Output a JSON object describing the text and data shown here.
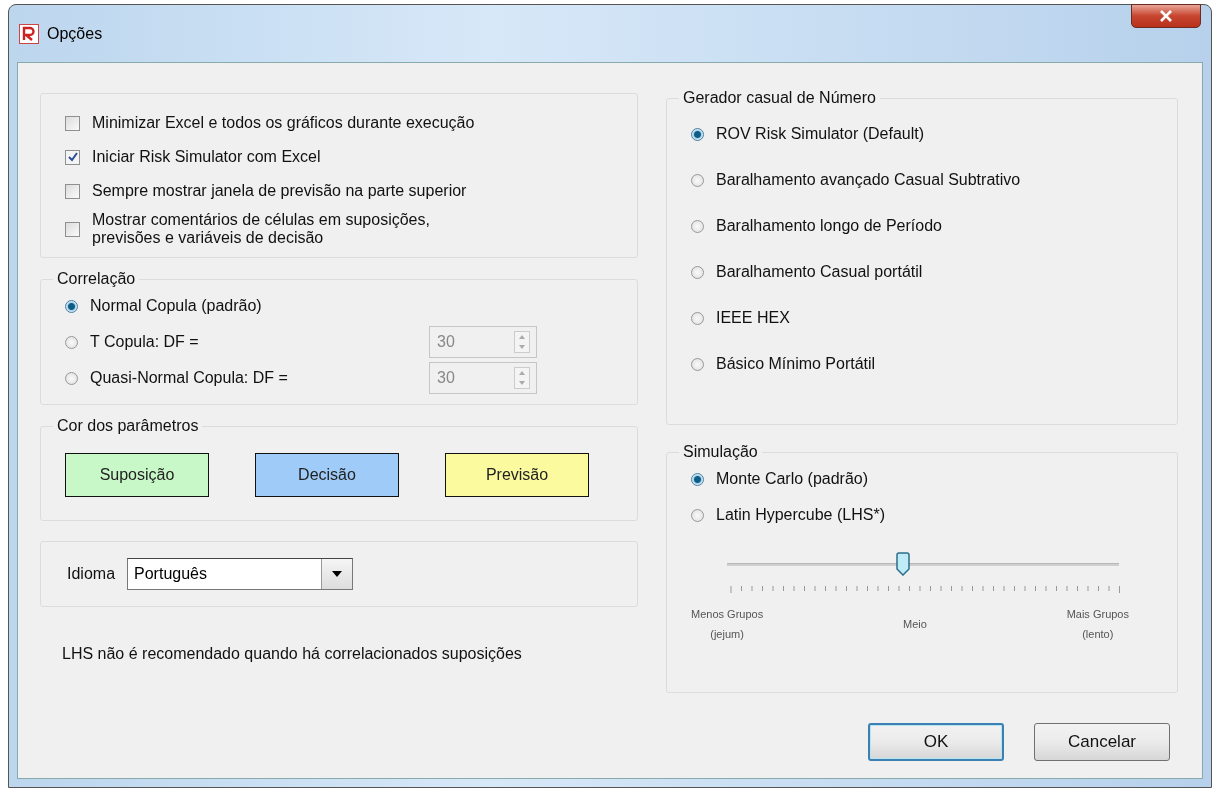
{
  "window": {
    "title": "Opções"
  },
  "general_options": [
    {
      "label": "Minimizar Excel e todos os gráficos durante execução",
      "checked": false
    },
    {
      "label": "Iniciar Risk Simulator com Excel",
      "checked": true
    },
    {
      "label": "Sempre mostrar janela de previsão na parte superior",
      "checked": false
    },
    {
      "label": "Mostrar comentários de células em suposições,\nprevisões e variáveis de decisão",
      "checked": false
    }
  ],
  "correlation": {
    "title": "Correlação",
    "options": [
      {
        "label": "Normal Copula (padrão)",
        "selected": true
      },
      {
        "label": "T Copula: DF =",
        "selected": false,
        "spinner": {
          "value": "30",
          "disabled": true
        }
      },
      {
        "label": "Quasi-Normal Copula: DF =",
        "selected": false,
        "spinner": {
          "value": "30",
          "disabled": true
        }
      }
    ]
  },
  "parameter_colors": {
    "title": "Cor dos parâmetros",
    "swatches": [
      {
        "label": "Suposição",
        "color": "#c8f7c8"
      },
      {
        "label": "Decisão",
        "color": "#9ecbf7"
      },
      {
        "label": "Previsão",
        "color": "#fbfa9e"
      }
    ]
  },
  "language": {
    "label": "Idioma",
    "value": "Português"
  },
  "note": "LHS não é recomendado quando há correlacionados suposições",
  "random_generator": {
    "title": "Gerador casual de Número",
    "options": [
      {
        "label": "ROV Risk Simulator (Default)",
        "selected": true
      },
      {
        "label": "Baralhamento avançado Casual Subtrativo",
        "selected": false
      },
      {
        "label": "Baralhamento longo de Período",
        "selected": false
      },
      {
        "label": "Baralhamento Casual portátil",
        "selected": false
      },
      {
        "label": "IEEE HEX",
        "selected": false
      },
      {
        "label": "Básico Mínimo Portátil",
        "selected": false
      }
    ]
  },
  "simulation": {
    "title": "Simulação",
    "options": [
      {
        "label": "Monte Carlo (padrão)",
        "selected": true
      },
      {
        "label": "Latin Hypercube (LHS*)",
        "selected": false
      }
    ],
    "slider": {
      "level": 0.45,
      "labels": [
        "Menos Grupos\n(jejum)",
        "Meio",
        "Mais Grupos\n(lento)"
      ]
    }
  },
  "buttons": [
    {
      "label": "OK",
      "default": true
    },
    {
      "label": "Cancelar",
      "default": false
    }
  ]
}
